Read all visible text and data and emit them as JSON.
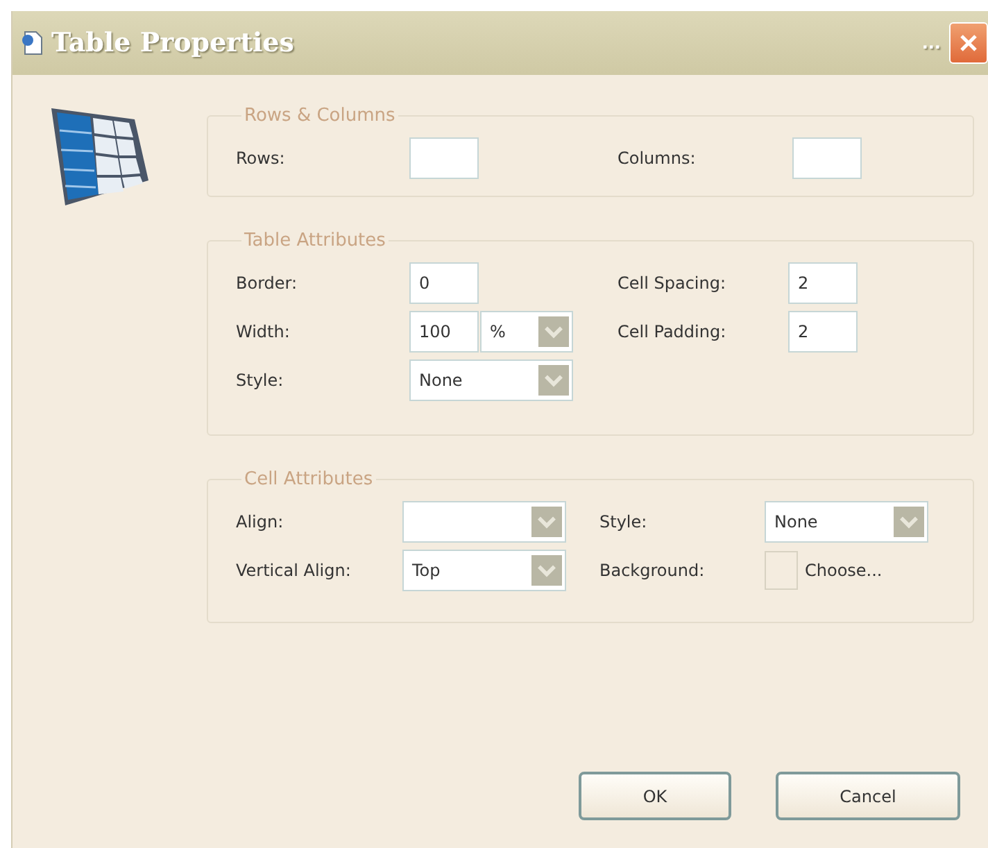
{
  "window": {
    "title": "Table Properties",
    "title_suffix": "..."
  },
  "groups": [
    {
      "title": "Rows & Columns",
      "rows": [
        [
          {
            "label": "Rows:",
            "control": {
              "kind": "text"
            }
          },
          {
            "label": "Columns:",
            "control": {
              "kind": "text"
            }
          }
        ]
      ]
    },
    {
      "title": "Table Attributes",
      "rows": [
        [
          {
            "label": "Border:",
            "control": {
              "kind": "text",
              "value": "0"
            }
          },
          {
            "label": "Cell Spacing:",
            "control": {
              "kind": "text",
              "value": "2"
            }
          }
        ],
        [
          {
            "label": "Width:",
            "control": {
              "kind": "text_unit",
              "value": "100",
              "unit": "%"
            }
          },
          {
            "label": "Cell Padding:",
            "control": {
              "kind": "text",
              "value": "2"
            }
          }
        ],
        [
          {
            "label": "Style:",
            "control": {
              "kind": "select",
              "value": "None"
            }
          }
        ]
      ]
    },
    {
      "title": "Cell Attributes",
      "rows": [
        [
          {
            "label": "Align:",
            "control": {
              "kind": "select"
            }
          },
          {
            "label": "Style:",
            "control": {
              "kind": "select",
              "value": "None"
            }
          }
        ],
        [
          {
            "label": "Vertical Align:",
            "control": {
              "kind": "select",
              "value": "Top"
            }
          },
          {
            "label": "Background:",
            "control": {
              "kind": "color",
              "button": "Choose..."
            }
          }
        ]
      ]
    }
  ],
  "buttons": [
    {
      "label": "OK"
    },
    {
      "label": "Cancel"
    }
  ]
}
